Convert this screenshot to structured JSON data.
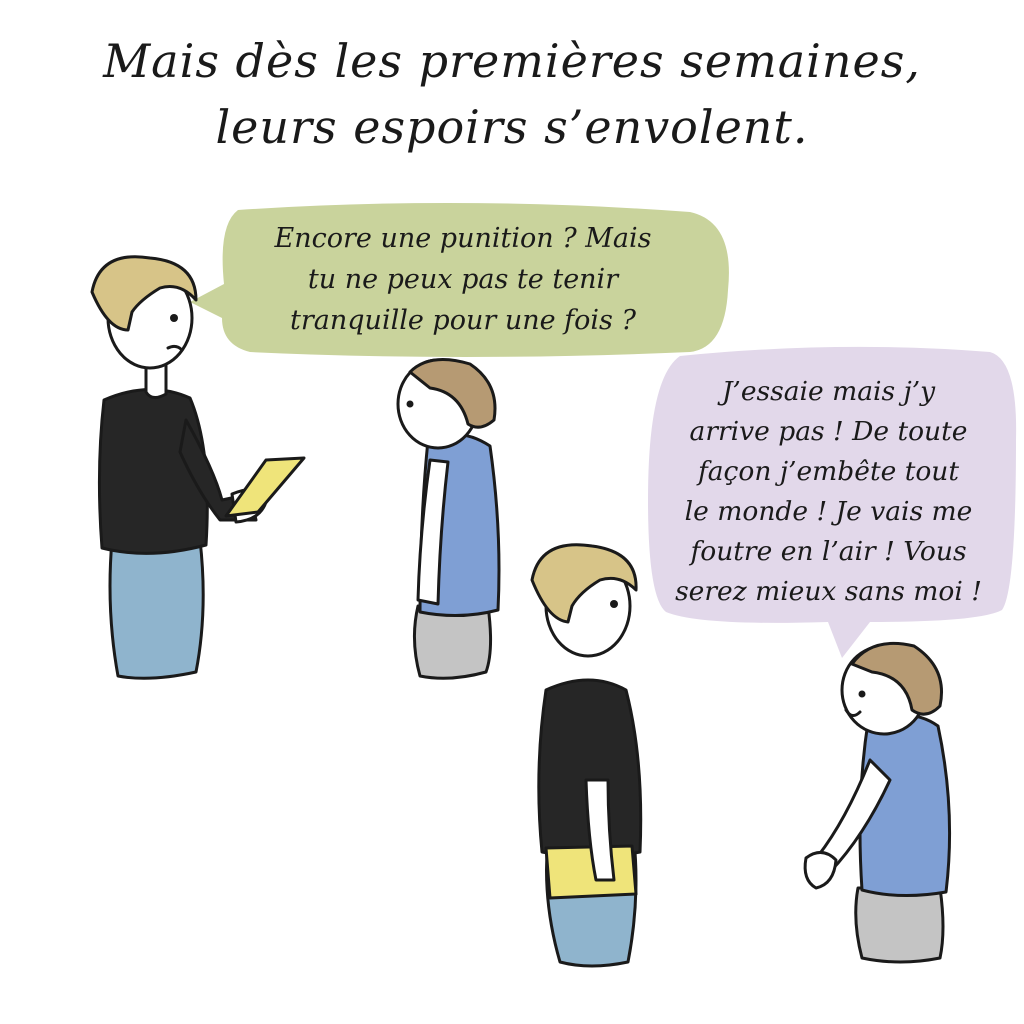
{
  "caption": {
    "line1": "Mais dès les premières semaines,",
    "line2": "leurs espoirs s’envolent."
  },
  "bubble_mother": {
    "lines": [
      "Encore une punition ? Mais",
      "tu ne peux pas te tenir",
      "tranquille pour une fois ?"
    ]
  },
  "bubble_son": {
    "lines": [
      "J’essaie mais j’y",
      "arrive pas ! De toute",
      "façon j’embête tout",
      "le monde ! Je vais me",
      "foutre en l’air ! Vous",
      "serez mieux sans moi !"
    ]
  },
  "colors": {
    "bubble_mother": "#c9d39c",
    "bubble_son": "#e2d8ea",
    "hair": "#d7c488",
    "hair_boy": "#b69a73",
    "skin": "#ffffff",
    "top_mother": "#262626",
    "skirt": "#8fb4cd",
    "shirt_boy": "#7f9fd4",
    "pants_boy": "#c4c4c4",
    "paper": "#efe47a",
    "outline": "#1a1a1a"
  }
}
